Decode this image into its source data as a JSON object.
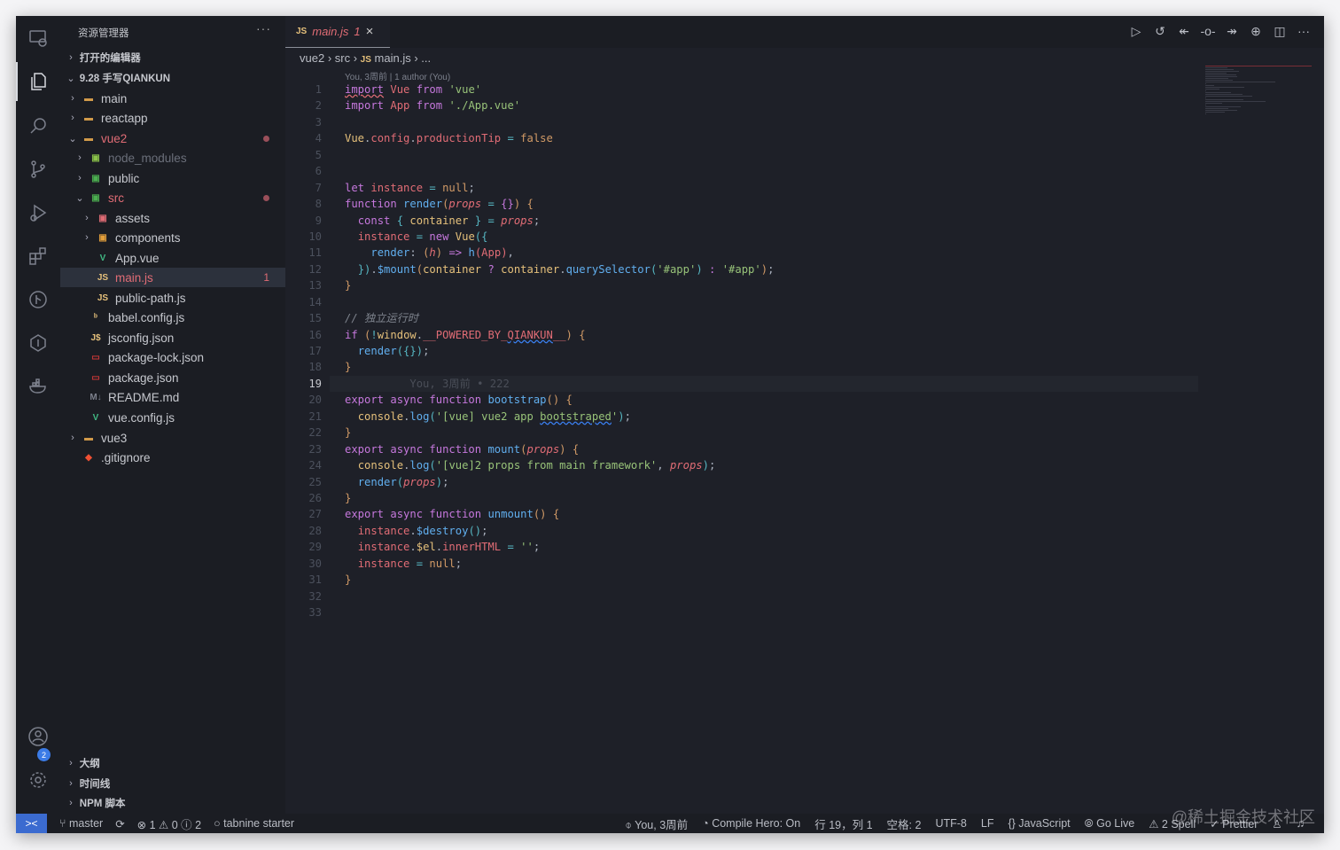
{
  "activity": [
    "remote-explorer",
    "explorer",
    "search",
    "source-control",
    "run-debug",
    "extensions",
    "gitlens",
    "timeline",
    "docker",
    "accounts",
    "settings"
  ],
  "accounts_badge": "2",
  "sidebar": {
    "title": "资源管理器",
    "more": "···",
    "rows": [
      {
        "label": "打开的编辑器",
        "type": "header",
        "chev": "›"
      },
      {
        "label": "9.28 手写QIANKUN",
        "type": "header",
        "chev": "⌄"
      },
      {
        "label": "main",
        "level": 1,
        "chev": "›",
        "icon": "folder"
      },
      {
        "label": "reactapp",
        "level": 1,
        "chev": "›",
        "icon": "folder"
      },
      {
        "label": "vue2",
        "level": 1,
        "chev": "⌄",
        "icon": "folder-open",
        "color": "#e06c75",
        "dot": true
      },
      {
        "label": "node_modules",
        "level": 2,
        "chev": "›",
        "icon": "folder-node",
        "color": "#6b6f7a"
      },
      {
        "label": "public",
        "level": 2,
        "chev": "›",
        "icon": "folder-public"
      },
      {
        "label": "src",
        "level": 2,
        "chev": "⌄",
        "icon": "folder-src",
        "color": "#e06c75",
        "dot": true
      },
      {
        "label": "assets",
        "level": 3,
        "chev": "›",
        "icon": "folder-assets"
      },
      {
        "label": "components",
        "level": 3,
        "chev": "›",
        "icon": "folder-components"
      },
      {
        "label": "App.vue",
        "level": 3,
        "icon": "vue"
      },
      {
        "label": "main.js",
        "level": 3,
        "icon": "js",
        "color": "#e06c75",
        "count": "1",
        "selected": true
      },
      {
        "label": "public-path.js",
        "level": 3,
        "icon": "js"
      },
      {
        "label": "babel.config.js",
        "level": 2,
        "icon": "babel"
      },
      {
        "label": "jsconfig.json",
        "level": 2,
        "icon": "jsconfig"
      },
      {
        "label": "package-lock.json",
        "level": 2,
        "icon": "npm"
      },
      {
        "label": "package.json",
        "level": 2,
        "icon": "npm"
      },
      {
        "label": "README.md",
        "level": 2,
        "icon": "markdown"
      },
      {
        "label": "vue.config.js",
        "level": 2,
        "icon": "vue-config"
      },
      {
        "label": "vue3",
        "level": 1,
        "chev": "›",
        "icon": "folder"
      },
      {
        "label": ".gitignore",
        "level": 1,
        "icon": "git"
      }
    ],
    "bottom": [
      "大纲",
      "时间线",
      "NPM 脚本"
    ]
  },
  "tab": {
    "icon": "JS",
    "name": "main.js",
    "problems": "1",
    "close": "×"
  },
  "toolbar": [
    "run-icon",
    "history-icon",
    "prev-change-icon",
    "commit-icon",
    "next-change-icon",
    "gitlens-icon",
    "split-editor-icon",
    "more-icon"
  ],
  "breadcrumb": [
    "vue2",
    "src",
    "main.js",
    "..."
  ],
  "blame_header": "You, 3周前 | 1 author (You)",
  "current_line": 19,
  "code": [
    [
      [
        "import",
        "k sq"
      ],
      [
        " "
      ],
      [
        "Vue",
        "v"
      ],
      [
        " "
      ],
      [
        "from",
        "k"
      ],
      [
        " "
      ],
      [
        "'vue'",
        "s"
      ]
    ],
    [
      [
        "import",
        "k"
      ],
      [
        " "
      ],
      [
        "App",
        "v"
      ],
      [
        " "
      ],
      [
        "from",
        "k"
      ],
      [
        " "
      ],
      [
        "'./App.vue'",
        "s"
      ]
    ],
    [],
    [
      [
        "Vue",
        "y"
      ],
      [
        "."
      ],
      [
        "config",
        "v"
      ],
      [
        "."
      ],
      [
        "productionTip",
        "v"
      ],
      [
        " "
      ],
      [
        "=",
        "o"
      ],
      [
        " "
      ],
      [
        "false",
        "b"
      ]
    ],
    [],
    [],
    [
      [
        "let",
        "k"
      ],
      [
        " "
      ],
      [
        "instance",
        "v"
      ],
      [
        " "
      ],
      [
        "=",
        "o"
      ],
      [
        " "
      ],
      [
        "null",
        "b"
      ],
      [
        ";"
      ]
    ],
    [
      [
        "function",
        "k"
      ],
      [
        " "
      ],
      [
        "render",
        "f"
      ],
      [
        "(",
        "b"
      ],
      [
        "props",
        "p"
      ],
      [
        " "
      ],
      [
        "=",
        "o"
      ],
      [
        " "
      ],
      [
        "{}",
        "k"
      ],
      [
        ")",
        "b"
      ],
      [
        " "
      ],
      [
        "{",
        "b"
      ]
    ],
    [
      [
        "  "
      ],
      [
        "const",
        "k"
      ],
      [
        " "
      ],
      [
        "{",
        "o"
      ],
      [
        " "
      ],
      [
        "container",
        "y"
      ],
      [
        " "
      ],
      [
        "}",
        "o"
      ],
      [
        " "
      ],
      [
        "=",
        "o"
      ],
      [
        " "
      ],
      [
        "props",
        "p"
      ],
      [
        ";"
      ]
    ],
    [
      [
        "  "
      ],
      [
        "instance",
        "v"
      ],
      [
        " "
      ],
      [
        "=",
        "o"
      ],
      [
        " "
      ],
      [
        "new",
        "k"
      ],
      [
        " "
      ],
      [
        "Vue",
        "y"
      ],
      [
        "({",
        "o"
      ]
    ],
    [
      [
        "    "
      ],
      [
        "render",
        "f"
      ],
      [
        ": "
      ],
      [
        "(",
        "b"
      ],
      [
        "h",
        "p"
      ],
      [
        ")",
        "b"
      ],
      [
        " "
      ],
      [
        "=>",
        "k"
      ],
      [
        " "
      ],
      [
        "h",
        "f"
      ],
      [
        "(",
        "v"
      ],
      [
        "App",
        "v"
      ],
      [
        ")",
        "v"
      ],
      [
        ","
      ]
    ],
    [
      [
        "  "
      ],
      [
        "})",
        "o"
      ],
      [
        "."
      ],
      [
        "$mount",
        "f"
      ],
      [
        "(",
        "b"
      ],
      [
        "container",
        "y"
      ],
      [
        " "
      ],
      [
        "?",
        "k"
      ],
      [
        " "
      ],
      [
        "container",
        "y"
      ],
      [
        "."
      ],
      [
        "querySelector",
        "f"
      ],
      [
        "(",
        "o"
      ],
      [
        "'#app'",
        "s"
      ],
      [
        ")",
        "o"
      ],
      [
        " "
      ],
      [
        ":",
        "k"
      ],
      [
        " "
      ],
      [
        "'#app'",
        "s"
      ],
      [
        ")",
        "b"
      ],
      [
        ";"
      ]
    ],
    [
      [
        "}",
        "b"
      ]
    ],
    [],
    [
      [
        "// 独立运行时",
        "c"
      ]
    ],
    [
      [
        "if",
        "k"
      ],
      [
        " "
      ],
      [
        "(",
        "b"
      ],
      [
        "!",
        "o"
      ],
      [
        "window",
        "y"
      ],
      [
        "."
      ],
      [
        "__POWERED_BY_",
        "v"
      ],
      [
        "QIANKUN",
        "v sqb"
      ],
      [
        "__",
        "v"
      ],
      [
        ")",
        "b"
      ],
      [
        " "
      ],
      [
        "{",
        "b"
      ]
    ],
    [
      [
        "  "
      ],
      [
        "render",
        "f"
      ],
      [
        "({})",
        "o"
      ],
      [
        ";"
      ]
    ],
    [
      [
        "}",
        "b"
      ]
    ],
    [
      [
        "          You, 3周前 • 222",
        "g"
      ]
    ],
    [
      [
        "export",
        "k"
      ],
      [
        " "
      ],
      [
        "async",
        "k"
      ],
      [
        " "
      ],
      [
        "function",
        "k"
      ],
      [
        " "
      ],
      [
        "bootstrap",
        "f"
      ],
      [
        "()",
        "b"
      ],
      [
        " "
      ],
      [
        "{",
        "b"
      ]
    ],
    [
      [
        "  "
      ],
      [
        "console",
        "y"
      ],
      [
        "."
      ],
      [
        "log",
        "f"
      ],
      [
        "(",
        "o"
      ],
      [
        "'[vue] vue2 app ",
        "s"
      ],
      [
        "bootstraped",
        "s sqb"
      ],
      [
        "'",
        "s"
      ],
      [
        ")",
        "o"
      ],
      [
        ";"
      ]
    ],
    [
      [
        "}",
        "b"
      ]
    ],
    [
      [
        "export",
        "k"
      ],
      [
        " "
      ],
      [
        "async",
        "k"
      ],
      [
        " "
      ],
      [
        "function",
        "k"
      ],
      [
        " "
      ],
      [
        "mount",
        "f"
      ],
      [
        "(",
        "b"
      ],
      [
        "props",
        "p"
      ],
      [
        ")",
        "b"
      ],
      [
        " "
      ],
      [
        "{",
        "b"
      ]
    ],
    [
      [
        "  "
      ],
      [
        "console",
        "y"
      ],
      [
        "."
      ],
      [
        "log",
        "f"
      ],
      [
        "(",
        "o"
      ],
      [
        "'[vue]2 props from main framework'",
        "s"
      ],
      [
        ", "
      ],
      [
        "props",
        "p"
      ],
      [
        ")",
        "o"
      ],
      [
        ";"
      ]
    ],
    [
      [
        "  "
      ],
      [
        "render",
        "f"
      ],
      [
        "(",
        "o"
      ],
      [
        "props",
        "p"
      ],
      [
        ")",
        "o"
      ],
      [
        ";"
      ]
    ],
    [
      [
        "}",
        "b"
      ]
    ],
    [
      [
        "export",
        "k"
      ],
      [
        " "
      ],
      [
        "async",
        "k"
      ],
      [
        " "
      ],
      [
        "function",
        "k"
      ],
      [
        " "
      ],
      [
        "unmount",
        "f"
      ],
      [
        "()",
        "b"
      ],
      [
        " "
      ],
      [
        "{",
        "b"
      ]
    ],
    [
      [
        "  "
      ],
      [
        "instance",
        "v"
      ],
      [
        "."
      ],
      [
        "$destroy",
        "f"
      ],
      [
        "()",
        "o"
      ],
      [
        ";"
      ]
    ],
    [
      [
        "  "
      ],
      [
        "instance",
        "v"
      ],
      [
        "."
      ],
      [
        "$el",
        "y"
      ],
      [
        "."
      ],
      [
        "innerHTML",
        "v"
      ],
      [
        " "
      ],
      [
        "=",
        "o"
      ],
      [
        " "
      ],
      [
        "''",
        "s"
      ],
      [
        ";"
      ]
    ],
    [
      [
        "  "
      ],
      [
        "instance",
        "v"
      ],
      [
        " "
      ],
      [
        "=",
        "o"
      ],
      [
        " "
      ],
      [
        "null",
        "b"
      ],
      [
        ";"
      ]
    ],
    [
      [
        "}",
        "b"
      ]
    ],
    [],
    []
  ],
  "status": {
    "branch": "master",
    "errors": "1",
    "warnings": "0",
    "infos": "2",
    "tabnine": "tabnine starter",
    "blame": "You, 3周前",
    "compile": "Compile Hero: On",
    "position": "行 19，列 1",
    "spaces": "空格: 2",
    "encoding": "UTF-8",
    "eol": "LF",
    "language": "JavaScript",
    "golive": "Go Live",
    "spell": "2 Spell",
    "prettier": "Prettier"
  },
  "watermark": "@稀土掘金技术社区"
}
